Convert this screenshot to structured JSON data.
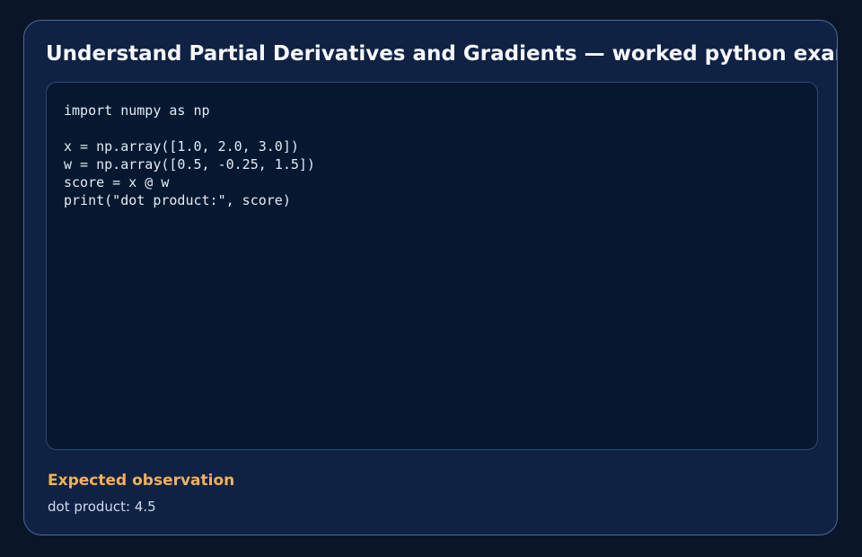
{
  "title": "Understand Partial Derivatives and Gradients — worked python example",
  "code": {
    "language": "python",
    "lines": [
      "import numpy as np",
      "",
      "x = np.array([1.0, 2.0, 3.0])",
      "w = np.array([0.5, -0.25, 1.5])",
      "score = x @ w",
      "print(\"dot product:\", score)"
    ]
  },
  "observation": {
    "heading": "Expected observation",
    "text": "dot product: 4.5"
  }
}
